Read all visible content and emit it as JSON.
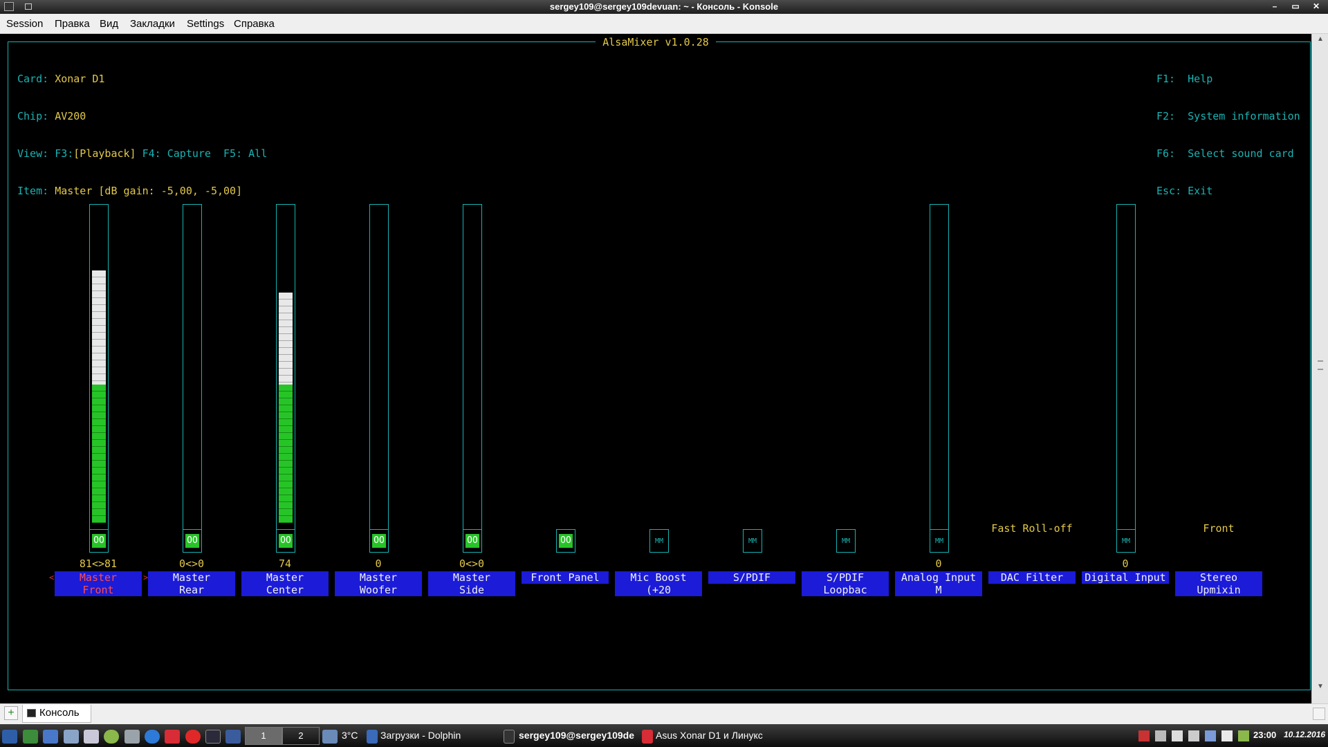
{
  "window": {
    "title": "sergey109@sergey109devuan: ~ - Консоль - Konsole",
    "buttons": [
      "–",
      "▭",
      "✕"
    ]
  },
  "menu": [
    "Session",
    "Правка",
    "Вид",
    "Закладки",
    "Settings",
    "Справка"
  ],
  "mixer": {
    "title": "AlsaMixer v1.0.28",
    "card_label": "Card:",
    "card": "Xonar D1",
    "chip_label": "Chip:",
    "chip": "AV200",
    "view_label": "View:",
    "view_f3": "F3:",
    "view_playback": "[Playback]",
    "view_f4": "F4: Capture",
    "view_f5": "F5: All",
    "item_label": "Item:",
    "item": "Master [dB gain: -5,00, -5,00]",
    "help": [
      {
        "key": "F1:",
        "desc": "Help"
      },
      {
        "key": "F2:",
        "desc": "System information"
      },
      {
        "key": "F6:",
        "desc": "Select sound card"
      },
      {
        "key": "Esc:",
        "desc": "Exit"
      }
    ],
    "controls": [
      {
        "label1": "Master",
        "label2": "Front",
        "value": "81<>81",
        "level": 0.81,
        "mute": "OO",
        "bar": true,
        "selected": true
      },
      {
        "label1": "Master",
        "label2": "Rear",
        "value": "0<>0",
        "level": 0,
        "mute": "OO",
        "bar": true
      },
      {
        "label1": "Master",
        "label2": "Center",
        "value": "74",
        "level": 0.74,
        "mute": "OO",
        "bar": true
      },
      {
        "label1": "Master",
        "label2": "Woofer",
        "value": "0",
        "level": 0,
        "mute": "OO",
        "bar": true
      },
      {
        "label1": "Master",
        "label2": "Side",
        "value": "0<>0",
        "level": 0,
        "mute": "OO",
        "bar": true
      },
      {
        "label1": "Front Panel",
        "label2": "",
        "value": "",
        "mute": "OO",
        "bar": false
      },
      {
        "label1": "Mic Boost (+20",
        "label2": "",
        "value": "",
        "mute": "MM",
        "bar": false
      },
      {
        "label1": "S/PDIF",
        "label2": "",
        "value": "",
        "mute": "MM",
        "bar": false
      },
      {
        "label1": "S/PDIF Loopbac",
        "label2": "",
        "value": "",
        "mute": "MM",
        "bar": false
      },
      {
        "label1": "Analog Input M",
        "label2": "",
        "value": "0",
        "level": 0,
        "mute": "MM",
        "bar": true
      },
      {
        "label1": "DAC Filter",
        "label2": "",
        "value": "",
        "enum": "Fast Roll-off",
        "bar": false
      },
      {
        "label1": "Digital Input",
        "label2": "",
        "value": "0",
        "level": 0,
        "mute": "MM",
        "bar": true
      },
      {
        "label1": "Stereo Upmixin",
        "label2": "",
        "value": "",
        "enum": "Front",
        "bar": false
      }
    ]
  },
  "tabs": {
    "active": "Консоль"
  },
  "taskbar": {
    "pager": [
      "1",
      "2"
    ],
    "weather": "3°C",
    "items": [
      "Загрузки - Dolphin",
      "sergey109@sergey109de",
      "Asus Xonar D1 и Линукс"
    ],
    "time": "23:00",
    "date": "10.12.2016"
  }
}
